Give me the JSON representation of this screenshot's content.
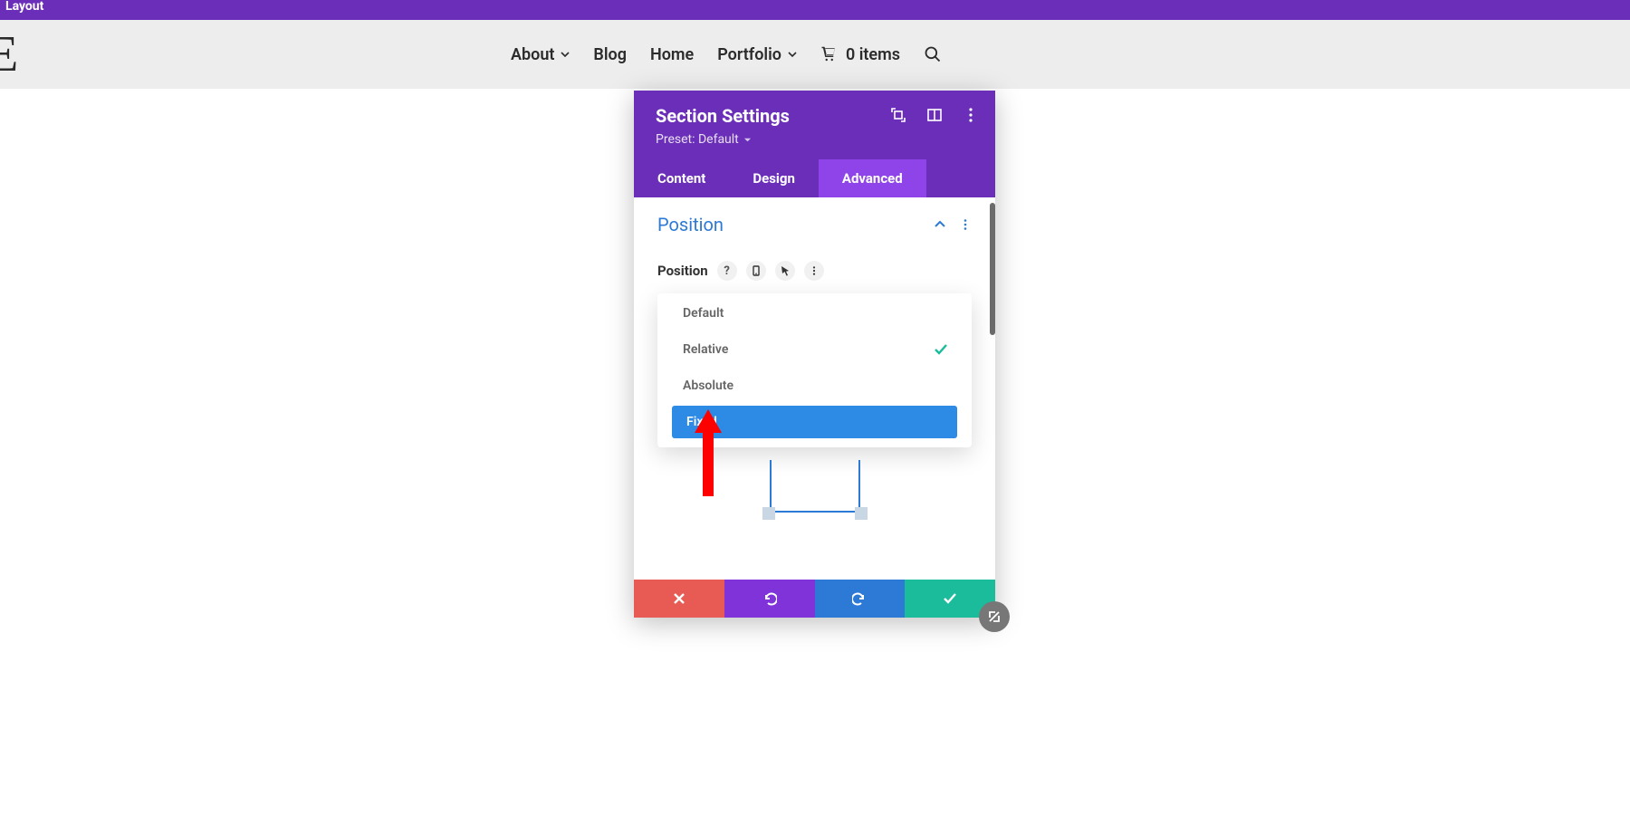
{
  "top_bar": {
    "label": "Layout"
  },
  "nav": {
    "about": "About",
    "blog": "Blog",
    "home": "Home",
    "portfolio": "Portfolio",
    "cart": "0 items"
  },
  "panel": {
    "title": "Section Settings",
    "preset_label": "Preset: Default",
    "tabs": {
      "content": "Content",
      "design": "Design",
      "advanced": "Advanced"
    },
    "section": {
      "title": "Position",
      "option_label": "Position"
    },
    "position_options": {
      "opt0": "Default",
      "opt1": "Relative",
      "opt2": "Absolute",
      "opt3": "Fixed"
    }
  }
}
